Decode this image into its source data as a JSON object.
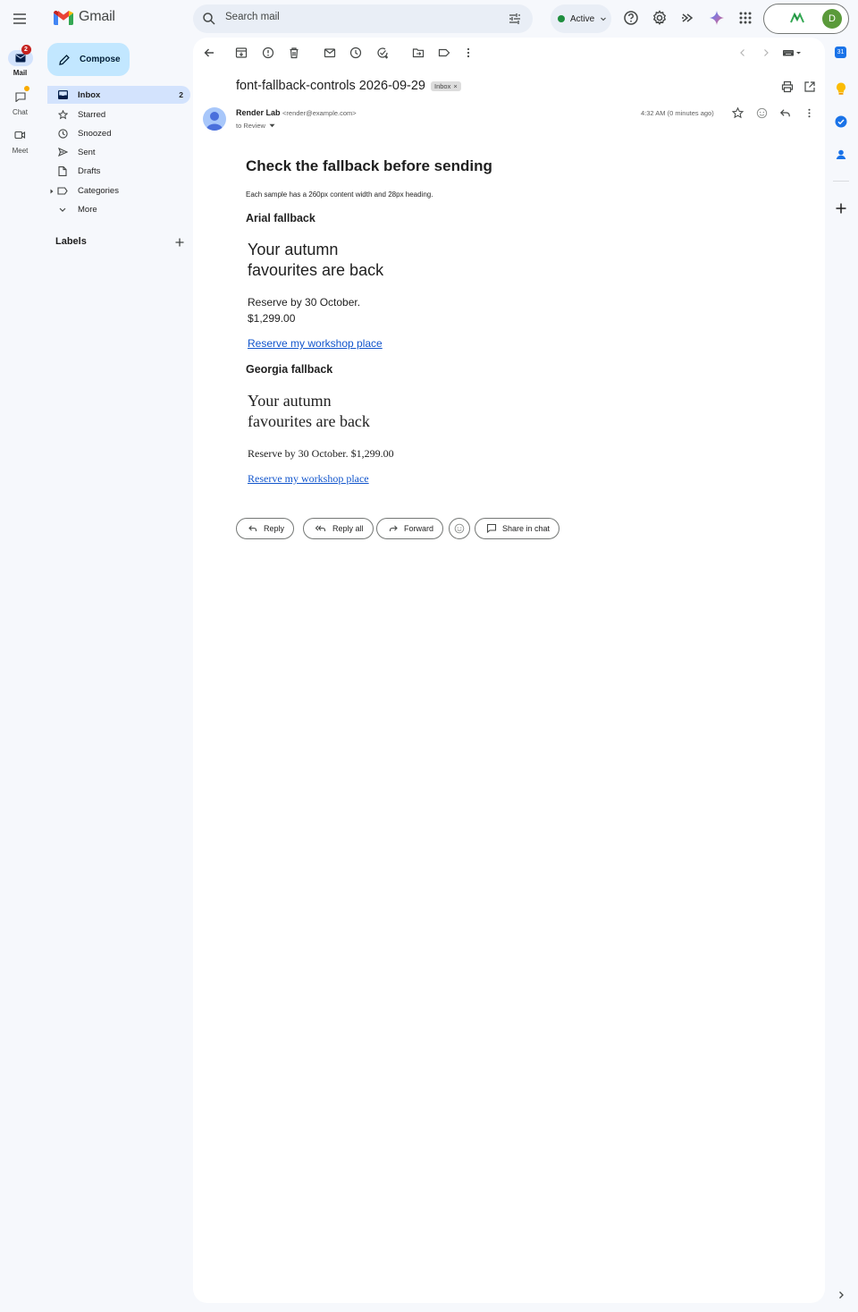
{
  "app": {
    "name": "Gmail"
  },
  "search": {
    "placeholder": "Search mail"
  },
  "status": {
    "label": "Active"
  },
  "account": {
    "initial": "D"
  },
  "rail": {
    "mail": {
      "label": "Mail",
      "badge": "2"
    },
    "chat": {
      "label": "Chat"
    },
    "meet": {
      "label": "Meet"
    }
  },
  "compose": {
    "label": "Compose"
  },
  "nav": {
    "items": [
      {
        "label": "Inbox",
        "count": "2"
      },
      {
        "label": "Starred"
      },
      {
        "label": "Snoozed"
      },
      {
        "label": "Sent"
      },
      {
        "label": "Drafts"
      },
      {
        "label": "Categories"
      },
      {
        "label": "More"
      }
    ],
    "labels_title": "Labels"
  },
  "message": {
    "subject": "font-fallback-controls 2026-09-29",
    "chip": "Inbox",
    "sender_name": "Render Lab",
    "sender_email": "<render@example.com>",
    "recipient": "to Review",
    "time": "4:32 AM (0 minutes ago)"
  },
  "body": {
    "heading": "Check the fallback before sending",
    "intro": "Each sample has a 260px content width and 28px heading.",
    "samples": [
      {
        "title": "Arial fallback",
        "heading_line1": "Your autumn",
        "heading_line2": "favourites are back",
        "para_line1": "Reserve by 30 October.",
        "para_line2": "$1,299.00",
        "link": "Reserve my workshop place"
      },
      {
        "title": "Georgia fallback",
        "heading_line1": "Your autumn",
        "heading_line2": "favourites are back",
        "para": "Reserve by 30 October. $1,299.00",
        "link": "Reserve my workshop place"
      }
    ]
  },
  "actions": {
    "reply": "Reply",
    "reply_all": "Reply all",
    "forward": "Forward",
    "share": "Share in chat"
  },
  "side": {
    "calendar_day": "31"
  },
  "colors": {
    "accent": "#0b57d0",
    "compose": "#c2e7ff",
    "active_nav": "#d3e3fd",
    "link": "#1155cc"
  }
}
